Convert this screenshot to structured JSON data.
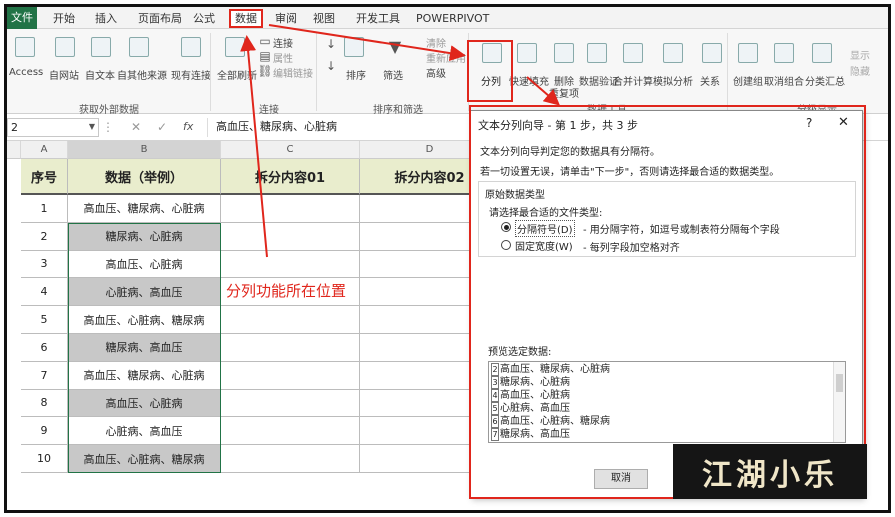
{
  "ribbon_tabs": {
    "file": "文件",
    "start": "开始",
    "insert": "插入",
    "layout": "页面布局",
    "formula": "公式",
    "data": "数据",
    "review": "审阅",
    "view": "视图",
    "developer": "开发工具",
    "powerpivot": "POWERPIVOT"
  },
  "ribbon": {
    "access": "Access",
    "web": "自网站",
    "text": "自文本",
    "other": "自其他来源",
    "existing": "现有连接",
    "refresh": "全部刷新",
    "connections": "连接",
    "properties": "属性",
    "edit_links": "编辑链接",
    "sort": "排序",
    "filter": "筛选",
    "clear": "清除",
    "reapply": "重新应用",
    "advanced": "高级",
    "split": "分列",
    "flash_fill": "快速填充",
    "remove_dup_1": "删除",
    "remove_dup_2": "重复项",
    "validate": "数据验证",
    "consolidate": "合并计算",
    "whatif": "模拟分析",
    "relations": "关系",
    "group": "创建组",
    "ungroup": "取消组合",
    "subtotal": "分类汇总",
    "show_detail": "显示",
    "hide_detail": "隐藏",
    "grp_external": "获取外部数据",
    "grp_connections": "连接",
    "grp_sort": "排序和筛选",
    "grp_tools": "数据工具",
    "grp_outline": "分级显示"
  },
  "formula_bar": {
    "name_box": "2",
    "fx": "fx",
    "content": "高血压、糖尿病、心脏病"
  },
  "columns": [
    "A",
    "B",
    "C",
    "D"
  ],
  "table": {
    "headers": [
      "序号",
      "数据（举例）",
      "拆分内容01",
      "拆分内容02"
    ],
    "rows": [
      {
        "n": "1",
        "data": "高血压、糖尿病、心脏病"
      },
      {
        "n": "2",
        "data": "糖尿病、心脏病"
      },
      {
        "n": "3",
        "data": "高血压、心脏病"
      },
      {
        "n": "4",
        "data": "心脏病、高血压"
      },
      {
        "n": "5",
        "data": "高血压、心脏病、糖尿病"
      },
      {
        "n": "6",
        "data": "糖尿病、高血压"
      },
      {
        "n": "7",
        "data": "高血压、糖尿病、心脏病"
      },
      {
        "n": "8",
        "data": "高血压、心脏病"
      },
      {
        "n": "9",
        "data": "心脏病、高血压"
      },
      {
        "n": "10",
        "data": "高血压、心脏病、糖尿病"
      }
    ]
  },
  "annotation": "分列功能所在位置",
  "dialog": {
    "title": "文本分列向导 - 第 1 步，共 3 步",
    "help": "?",
    "close": "✕",
    "intro": "文本分列向导判定您的数据具有分隔符。",
    "hint": "若一切设置无误，请单击\"下一步\"，否则请选择最合适的数据类型。",
    "section": "原始数据类型",
    "choose": "请选择最合适的文件类型:",
    "opt1": "分隔符号(D)",
    "opt1_desc": "- 用分隔字符，如逗号或制表符分隔每个字段",
    "opt2": "固定宽度(W)",
    "opt2_desc": "- 每列字段加空格对齐",
    "preview_label": "预览选定数据:",
    "preview_nums": [
      "2",
      "3",
      "4",
      "5",
      "6",
      "7"
    ],
    "preview_lines": [
      "高血压、糖尿病、心脏病",
      "糖尿病、心脏病",
      "高血压、心脏病",
      "心脏病、高血压",
      "高血压、心脏病、糖尿病",
      "糖尿病、高血压"
    ],
    "cancel": "取消"
  },
  "watermark": "江湖小乐",
  "colors": {
    "accent_red": "#e0261c",
    "excel_green": "#217346",
    "header_fill": "#e9edcd",
    "selected_fill": "#c8c8c8"
  }
}
